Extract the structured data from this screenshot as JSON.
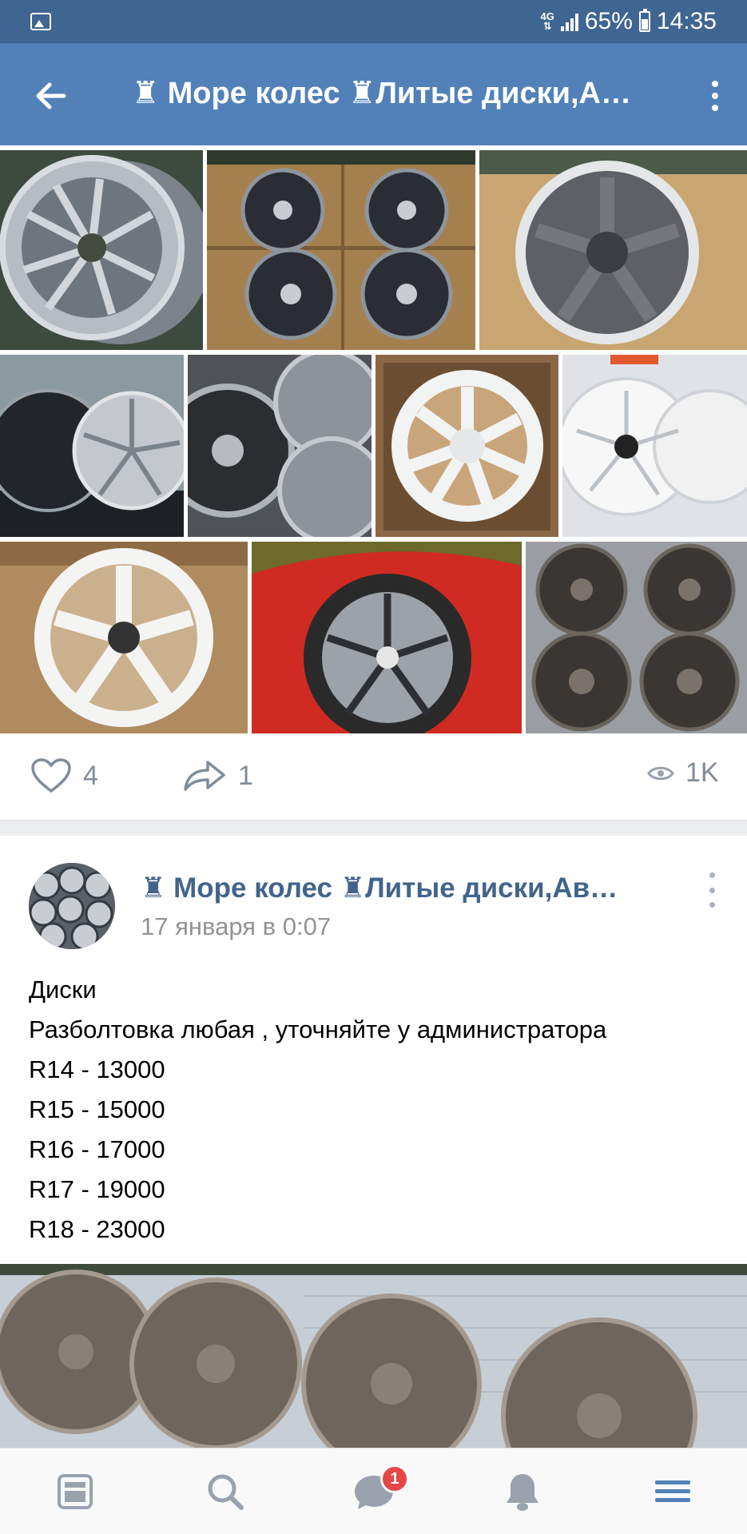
{
  "status_bar": {
    "network": "4G",
    "battery_percent": "65%",
    "time": "14:35",
    "battery_level": 0.65
  },
  "toolbar": {
    "title": "♜ Море колес ♜Литые диски,А…",
    "back_icon": "arrow-left-icon",
    "more_icon": "more-vertical-icon"
  },
  "photo_grid": {
    "photos": [
      {
        "name": "silver-spoke-wheel",
        "tone": "#9aa0a6"
      },
      {
        "name": "four-wheels-in-boxes",
        "tone": "#b8915f"
      },
      {
        "name": "gunmetal-wheel-in-box",
        "tone": "#c7a16e"
      },
      {
        "name": "black-and-silver-wheels",
        "tone": "#2c3036"
      },
      {
        "name": "mesh-wheels-stack",
        "tone": "#6e7278"
      },
      {
        "name": "white-wheel-in-box",
        "tone": "#8a6643"
      },
      {
        "name": "white-wheels-display",
        "tone": "#d8dde3"
      },
      {
        "name": "white-five-spoke-in-box",
        "tone": "#b08b60"
      },
      {
        "name": "red-car-wheel",
        "tone": "#cc2a21"
      },
      {
        "name": "bronze-wheels-on-pavement",
        "tone": "#7f8286"
      }
    ]
  },
  "actions": {
    "likes": "4",
    "shares": "1",
    "views": "1K"
  },
  "post": {
    "author": "♜ Море колес ♜Литые диски,Ав…",
    "date": "17 января в 0:07",
    "lines": [
      "Диски",
      "Разболтовка любая , уточняйте у администратора",
      "R14 - 13000",
      "R15 - 15000",
      "R16 - 17000",
      "R17 - 19000",
      "R18 - 23000"
    ]
  },
  "bottom_nav": {
    "items": [
      "news-icon",
      "search-icon",
      "messages-icon",
      "notifications-icon",
      "menu-icon"
    ],
    "messages_badge": "1",
    "active_color": "#5181b8",
    "inactive_color": "#99a2ad"
  }
}
